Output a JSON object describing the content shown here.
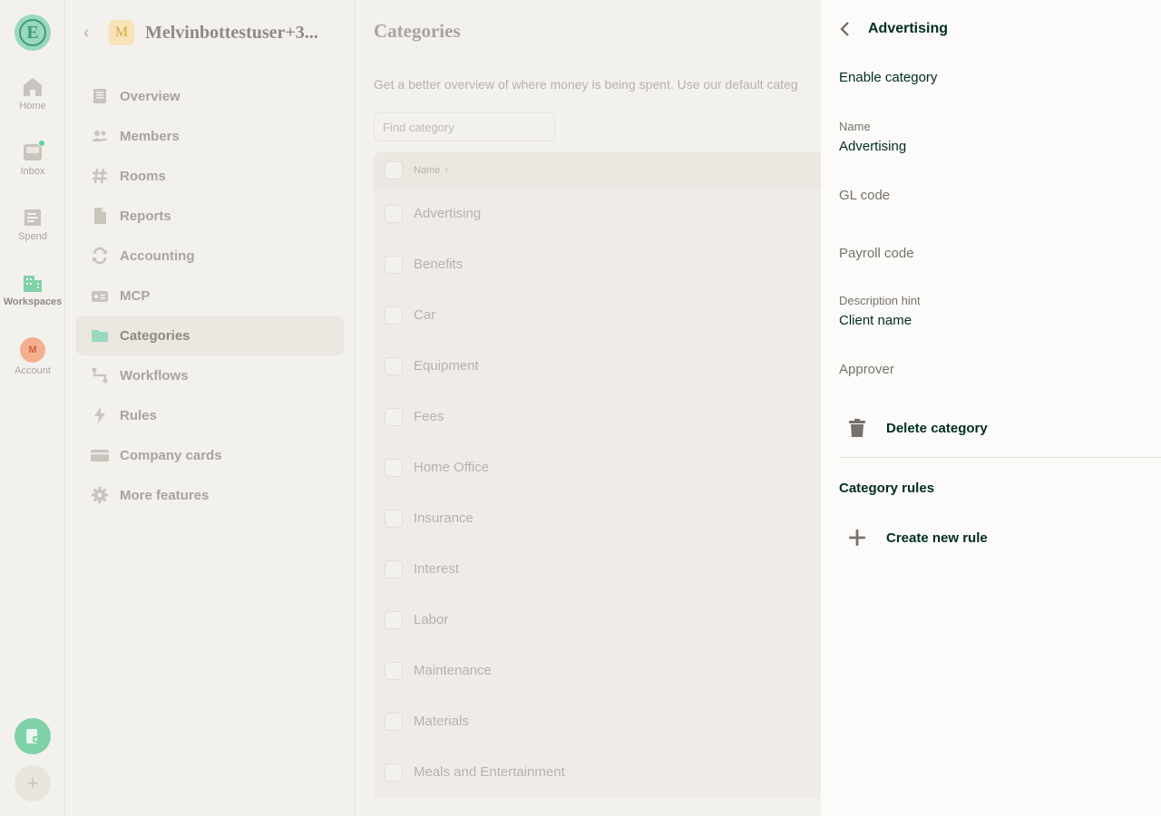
{
  "colors": {
    "accent": "#03d47c",
    "text_primary": "#002e22",
    "text_muted": "#76726b",
    "background": "#fcfbf9",
    "dimmed": "#f3f1ed"
  },
  "nav_rail": {
    "logo_letter": "E",
    "items": [
      {
        "label": "Home",
        "icon": "home-icon"
      },
      {
        "label": "Inbox",
        "icon": "inbox-icon"
      },
      {
        "label": "Spend",
        "icon": "receipt-icon"
      },
      {
        "label": "Workspaces",
        "icon": "building-icon"
      },
      {
        "label": "Account",
        "icon": "avatar"
      }
    ],
    "account_initial": "M"
  },
  "sidebar": {
    "workspace_initial": "M",
    "workspace_name": "Melvinbottestuser+3...",
    "items": [
      {
        "label": "Overview",
        "icon": "document-icon"
      },
      {
        "label": "Members",
        "icon": "users-icon"
      },
      {
        "label": "Rooms",
        "icon": "hashtag-icon"
      },
      {
        "label": "Reports",
        "icon": "file-icon"
      },
      {
        "label": "Accounting",
        "icon": "sync-icon"
      },
      {
        "label": "MCP",
        "icon": "plug-icon"
      },
      {
        "label": "Categories",
        "icon": "folder-icon"
      },
      {
        "label": "Workflows",
        "icon": "workflow-icon"
      },
      {
        "label": "Rules",
        "icon": "bolt-icon"
      },
      {
        "label": "Company cards",
        "icon": "card-icon"
      },
      {
        "label": "More features",
        "icon": "gear-icon"
      }
    ]
  },
  "main": {
    "title": "Categories",
    "description": "Get a better overview of where money is being spent. Use our default categ",
    "search_placeholder": "Find category",
    "column_name": "Name",
    "sort_arrow": "↑",
    "rows": [
      "Advertising",
      "Benefits",
      "Car",
      "Equipment",
      "Fees",
      "Home Office",
      "Insurance",
      "Interest",
      "Labor",
      "Maintenance",
      "Materials",
      "Meals and Entertainment"
    ]
  },
  "panel": {
    "title": "Advertising",
    "enable_label": "Enable category",
    "name_label": "Name",
    "name_value": "Advertising",
    "gl_code_label": "GL code",
    "payroll_code_label": "Payroll code",
    "description_hint_label": "Description hint",
    "description_hint_value": "Client name",
    "approver_label": "Approver",
    "delete_label": "Delete category",
    "rules_section_title": "Category rules",
    "create_rule_label": "Create new rule"
  }
}
